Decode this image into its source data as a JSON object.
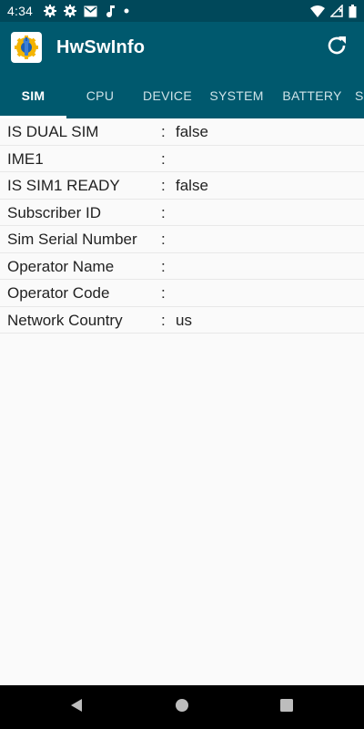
{
  "status_bar": {
    "time": "4:34",
    "icons": [
      "gear-icon",
      "gear-icon",
      "mail-icon",
      "music-note-icon",
      "dot-icon",
      "wifi-icon",
      "signal-icon",
      "battery-icon"
    ]
  },
  "app_bar": {
    "title": "HwSwInfo",
    "icon": "wrench-gear-icon",
    "action_icon": "refresh-icon"
  },
  "tabs": [
    {
      "label": "SIM",
      "active": true
    },
    {
      "label": "CPU",
      "active": false
    },
    {
      "label": "DEVICE",
      "active": false
    },
    {
      "label": "SYSTEM",
      "active": false
    },
    {
      "label": "BATTERY",
      "active": false
    },
    {
      "label": "S",
      "active": false
    }
  ],
  "sim_info": {
    "separator": ":",
    "rows": [
      {
        "label": "IS DUAL SIM",
        "value": "false"
      },
      {
        "label": "IME1",
        "value": ""
      },
      {
        "label": "IS SIM1 READY",
        "value": "false"
      },
      {
        "label": "Subscriber ID",
        "value": ""
      },
      {
        "label": "Sim Serial Number",
        "value": ""
      },
      {
        "label": "Operator Name",
        "value": ""
      },
      {
        "label": "Operator Code",
        "value": ""
      },
      {
        "label": "Network Country",
        "value": "us"
      }
    ]
  },
  "nav_bar": {
    "buttons": [
      "back-icon",
      "home-icon",
      "recents-icon"
    ]
  },
  "colors": {
    "primary": "#00596e",
    "status_bar": "#00485a",
    "background": "#fafafa"
  }
}
